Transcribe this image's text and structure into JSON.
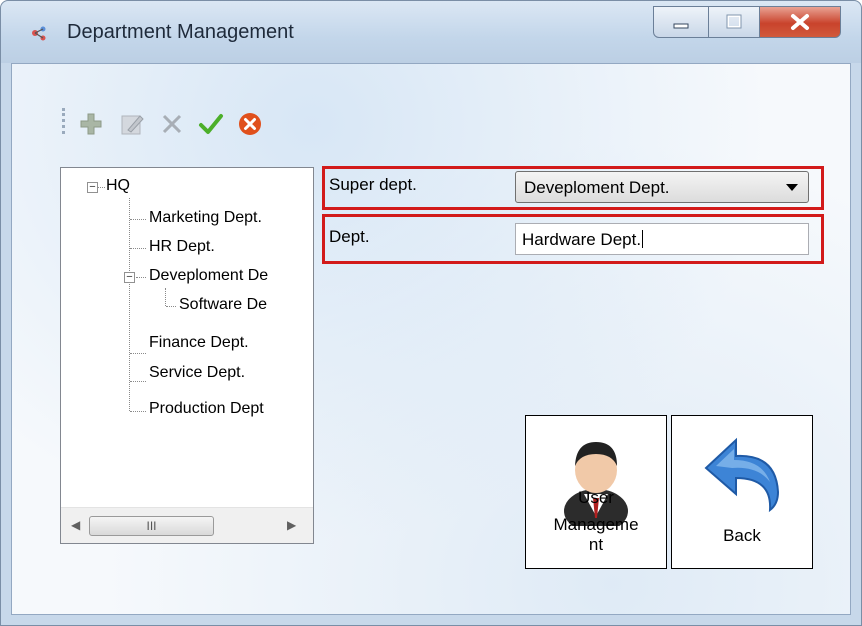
{
  "window": {
    "title": "Department Management",
    "icon": "department-app-icon",
    "controls": [
      "minimize-icon",
      "maximize-icon",
      "close-icon"
    ]
  },
  "toolbar": {
    "buttons": [
      {
        "name": "add",
        "icon": "plus-icon"
      },
      {
        "name": "edit",
        "icon": "pencil-icon"
      },
      {
        "name": "delete",
        "icon": "x-icon"
      },
      {
        "name": "confirm",
        "icon": "checkmark-icon"
      },
      {
        "name": "cancel",
        "icon": "cancel-circle-icon"
      }
    ]
  },
  "tree": {
    "root": "HQ",
    "items": [
      "Marketing Dept.",
      "HR Dept.",
      "Deveploment De",
      "Software De",
      "Finance Dept.",
      "Service Dept.",
      "Production Dept"
    ],
    "scroll_thumb": "III"
  },
  "form": {
    "super_dept_label": "Super dept.",
    "super_dept_value": "Deveploment Dept.",
    "dept_label": "Dept.",
    "dept_value": "Hardware Dept."
  },
  "buttons": {
    "user_management_line1": "User",
    "user_management_line2": "Manageme",
    "user_management_line3": "nt",
    "back": "Back"
  },
  "colors": {
    "highlight": "#d21a1a",
    "confirm": "#4caf2a",
    "cancel": "#e0501c"
  }
}
